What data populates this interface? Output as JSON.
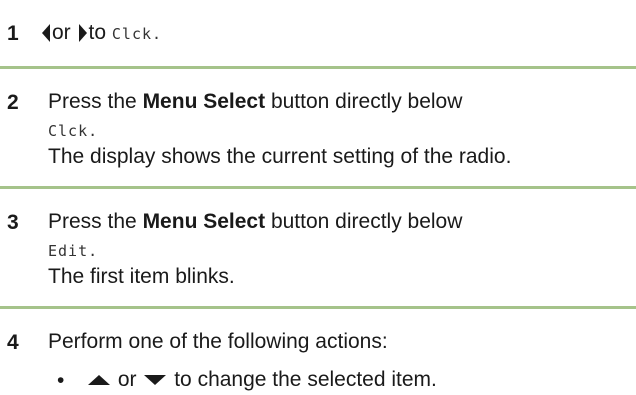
{
  "steps": [
    {
      "number": "1",
      "line1_mid": "or",
      "line1_to": "to",
      "line1_code": "Clck.",
      "icons": [
        "left-arrow-icon",
        "right-arrow-icon"
      ]
    },
    {
      "number": "2",
      "pre": "Press the",
      "bold": "Menu Select",
      "post": "button directly below",
      "code": "Clck",
      "code_end": ".",
      "note": "The display shows the current setting of the radio."
    },
    {
      "number": "3",
      "pre": "Press the",
      "bold": "Menu Select",
      "post": "button directly below",
      "code": "Edit",
      "code_end": ".",
      "note": "The first item blinks."
    },
    {
      "number": "4",
      "text": "Perform one of the following actions:",
      "bullet": "•",
      "bullet_mid": "or",
      "bullet_text": "to change the selected item.",
      "icons": [
        "up-arrow-icon",
        "down-arrow-icon"
      ]
    }
  ],
  "colors": {
    "rule": "#a5c38a",
    "text": "#1a1a1a"
  }
}
